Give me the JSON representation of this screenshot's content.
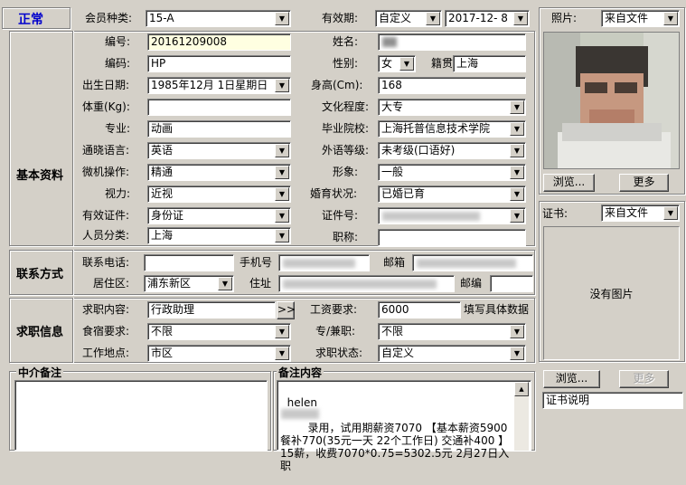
{
  "status": "正常",
  "header": {
    "member_type_label": "会员种类:",
    "member_type_value": "15-A",
    "validity_label": "有效期:",
    "validity_type": "自定义",
    "validity_date": "2017-12- 8"
  },
  "basic": {
    "section_title": "基本资料",
    "id_label": "编号:",
    "id_value": "20161209008",
    "name_label": "姓名:",
    "code_label": "编码:",
    "code_value": "HP",
    "gender_label": "性别:",
    "gender_value": "女",
    "native_label": "籍贯",
    "native_value": "上海",
    "birth_label": "出生日期:",
    "birth_value": "1985年12月 1日星期日",
    "height_label": "身高(Cm):",
    "height_value": "168",
    "weight_label": "体重(Kg):",
    "weight_value": "",
    "education_label": "文化程度:",
    "education_value": "大专",
    "major_label": "专业:",
    "major_value": "动画",
    "school_label": "毕业院校:",
    "school_value": "上海托普信息技术学院",
    "language_label": "通晓语言:",
    "language_value": "英语",
    "lang_level_label": "外语等级:",
    "lang_level_value": "未考级(口语好)",
    "computer_label": "微机操作:",
    "computer_value": "精通",
    "image_label": "形象:",
    "image_value": "一般",
    "vision_label": "视力:",
    "vision_value": "近视",
    "marital_label": "婚育状况:",
    "marital_value": "已婚已育",
    "cert_type_label": "有效证件:",
    "cert_type_value": "身份证",
    "cert_no_label": "证件号:",
    "category_label": "人员分类:",
    "category_value": "上海",
    "title_label": "职称:",
    "title_value": ""
  },
  "contact": {
    "section_title": "联系方式",
    "phone_label": "联系电话:",
    "phone_value": "",
    "mobile_label": "手机号",
    "email_label": "邮箱",
    "district_label": "居住区:",
    "district_value": "浦东新区",
    "address_label": "住址",
    "zip_label": "邮编",
    "zip_value": ""
  },
  "job": {
    "section_title": "求职信息",
    "content_label": "求职内容:",
    "content_value": "行政助理",
    "more_btn": ">>",
    "salary_label": "工资要求:",
    "salary_value": "6000",
    "salary_hint": "填写具体数据",
    "lodging_label": "食宿要求:",
    "lodging_value": "不限",
    "fulltime_label": "专/兼职:",
    "fulltime_value": "不限",
    "location_label": "工作地点:",
    "location_value": "市区",
    "status_label": "求职状态:",
    "status_value": "自定义"
  },
  "notes": {
    "agent_title": "中介备注",
    "agent_text": "",
    "remark_title": "备注内容",
    "remark_text": "helen\n\n        录用，试用期薪资7070 【基本薪资5900 餐补770(35元一天 22个工作日) 交通补400 】15薪，收费7070*0.75=5302.5元 2月27日入职"
  },
  "photo": {
    "label": "照片:",
    "source": "来自文件",
    "browse_btn": "浏览...",
    "more_btn": "更多"
  },
  "certificate": {
    "label": "证书:",
    "source": "来自文件",
    "no_image": "没有图片",
    "browse_btn": "浏览...",
    "more_btn": "更多",
    "desc_value": "证书说明"
  },
  "colors": {
    "status": "#0000cc",
    "panel_bg": "#d4d0c8",
    "id_field_bg": "#ffffe1"
  }
}
